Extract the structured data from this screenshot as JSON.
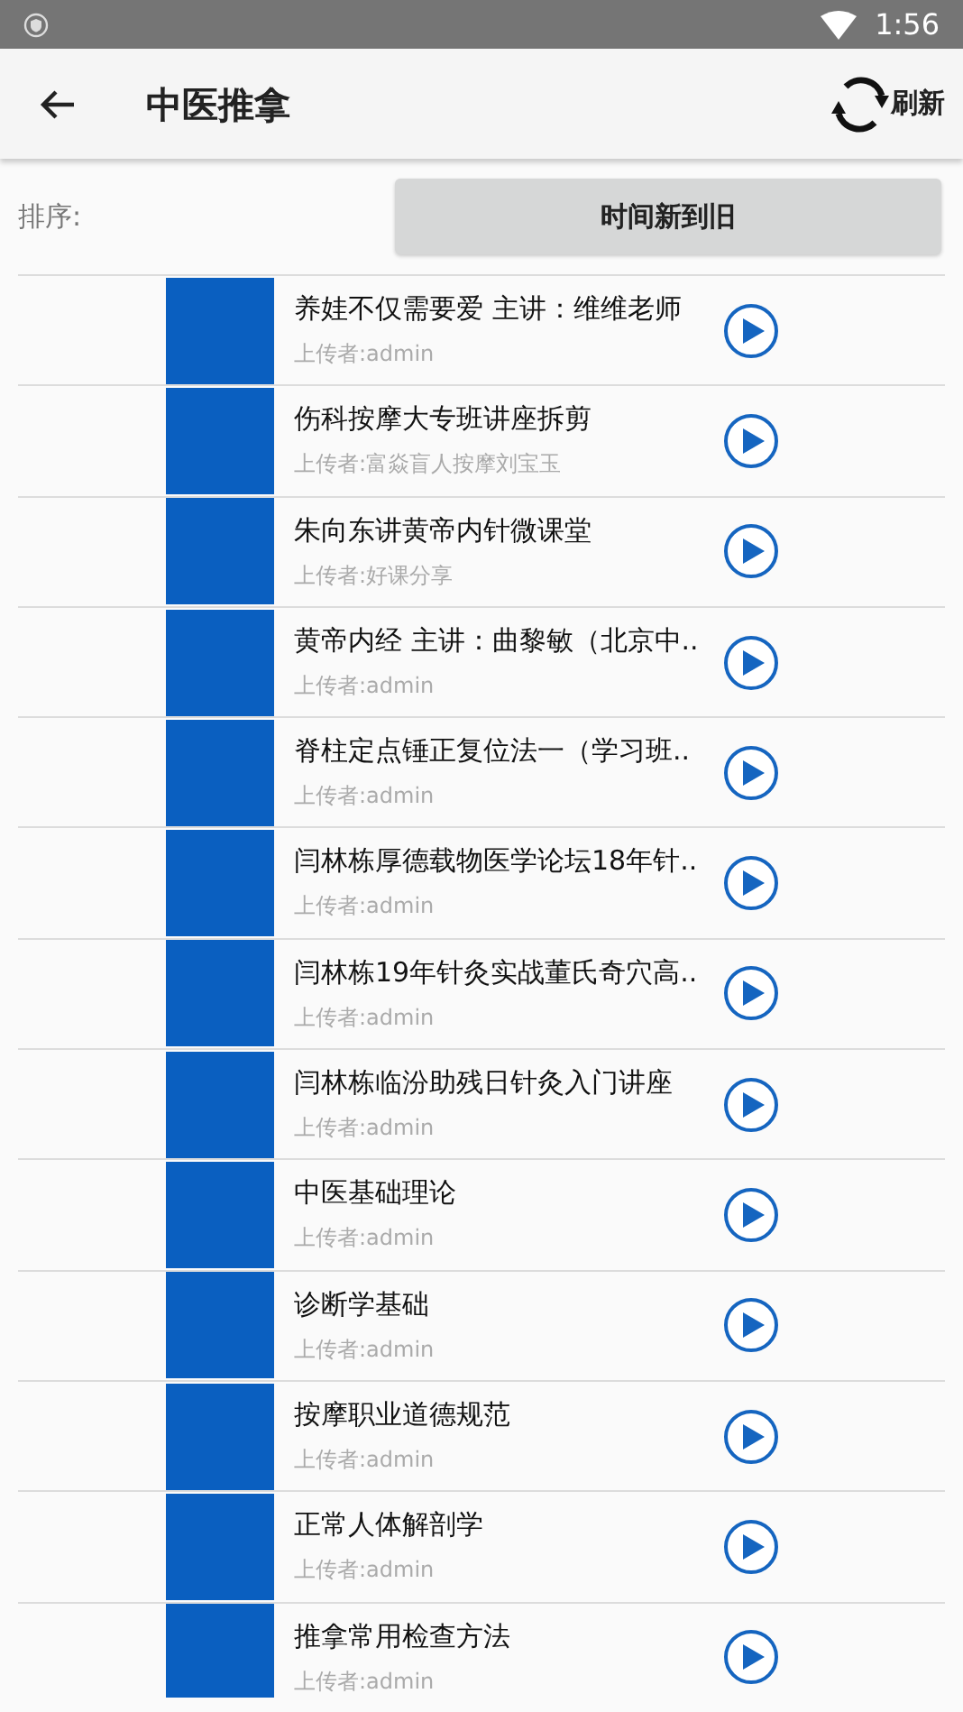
{
  "status_bar": {
    "time": "1:56"
  },
  "app_bar": {
    "title": "中医推拿",
    "refresh_label": "刷新"
  },
  "sort": {
    "label": "排序:",
    "value": "时间新到旧"
  },
  "videos": [
    {
      "title": "养娃不仅需要爱 主讲：维维老师",
      "uploader": "上传者:admin"
    },
    {
      "title": "伤科按摩大专班讲座拆剪",
      "uploader": "上传者:富焱盲人按摩刘宝玉"
    },
    {
      "title": "朱向东讲黄帝内针微课堂",
      "uploader": "上传者:好课分享"
    },
    {
      "title": "黄帝内经 主讲：曲黎敏（北京中..",
      "uploader": "上传者:admin"
    },
    {
      "title": "脊柱定点锤正复位法一（学习班..",
      "uploader": "上传者:admin"
    },
    {
      "title": "闫林栋厚德载物医学论坛18年针..",
      "uploader": "上传者:admin"
    },
    {
      "title": "闫林栋19年针灸实战董氏奇穴高..",
      "uploader": "上传者:admin"
    },
    {
      "title": "闫林栋临汾助残日针灸入门讲座",
      "uploader": "上传者:admin"
    },
    {
      "title": "中医基础理论",
      "uploader": "上传者:admin"
    },
    {
      "title": "诊断学基础",
      "uploader": "上传者:admin"
    },
    {
      "title": "按摩职业道德规范",
      "uploader": "上传者:admin"
    },
    {
      "title": "正常人体解剖学",
      "uploader": "上传者:admin"
    },
    {
      "title": "推拿常用检查方法",
      "uploader": "上传者:admin"
    }
  ]
}
